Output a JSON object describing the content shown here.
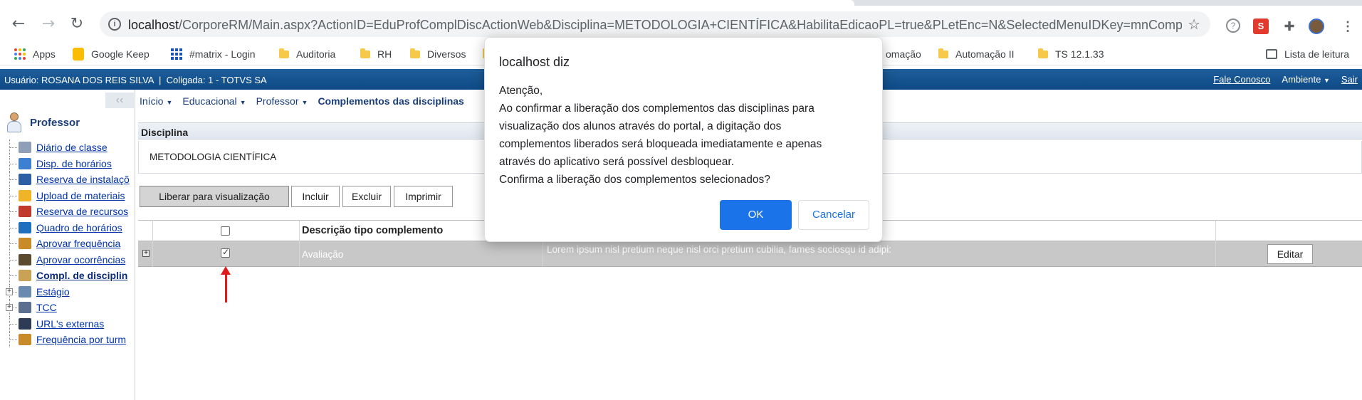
{
  "browser": {
    "url_host": "localhost",
    "url_path": "/CorporeRM/Main.aspx?ActionID=EduProfComplDiscActionWeb&Disciplina=METODOLOGIA+CIENTÍFICA&HabilitaEdicaoPL=true&PLetEnc=N&SelectedMenuIDKey=mnComplDisc...",
    "bookmarks": [
      "Apps",
      "Google Keep",
      "#matrix - Login",
      "Auditoria",
      "RH",
      "Diversos",
      "omação",
      "Automação II",
      "TS 12.1.33"
    ],
    "reading_list": "Lista de leitura",
    "icons": [
      "back-icon",
      "forward-icon",
      "reload-icon",
      "info-icon",
      "star-icon",
      "help-icon",
      "extension-icon",
      "menu-icon"
    ]
  },
  "header": {
    "user_line": "Usuário: ROSANA DOS REIS SILVA  |  Coligada: 1 - TOTVS SA",
    "fale_conosco": "Fale Conosco",
    "ambiente": "Ambiente",
    "sair": "Sair"
  },
  "sidebar": {
    "collapse_glyph": "‹‹",
    "title": "Professor",
    "items": [
      {
        "label": "Diário de classe",
        "icon_color": "#8f9fb8"
      },
      {
        "label": "Disp. de horários",
        "icon_color": "#3d7fd1"
      },
      {
        "label": "Reserva de instalaçõ",
        "icon_color": "#2b5ea3"
      },
      {
        "label": "Upload de materiais",
        "icon_color": "#f0b429"
      },
      {
        "label": "Reserva de recursos",
        "icon_color": "#c0392b"
      },
      {
        "label": "Quadro de horários",
        "icon_color": "#1f6fbf"
      },
      {
        "label": "Aprovar frequência",
        "icon_color": "#c98b2a"
      },
      {
        "label": "Aprovar ocorrências",
        "icon_color": "#5b4a2e"
      },
      {
        "label": "Compl. de disciplin",
        "icon_color": "#c9a255"
      },
      {
        "label": "Estágio",
        "icon_color": "#6a8ab0"
      },
      {
        "label": "TCC",
        "icon_color": "#5a6f8f"
      },
      {
        "label": "URL's externas",
        "icon_color": "#2e3b55"
      },
      {
        "label": "Frequência por turm",
        "icon_color": "#c98b2a"
      }
    ]
  },
  "breadcrumb": {
    "inicio": "Início",
    "educacional": "Educacional",
    "professor": "Professor",
    "current": "Complementos das disciplinas"
  },
  "disciplina": {
    "label": "Disciplina",
    "value": "METODOLOGIA CIENTÍFICA"
  },
  "toolbar": {
    "liberar": "Liberar para visualização",
    "incluir": "Incluir",
    "excluir": "Excluir",
    "imprimir": "Imprimir"
  },
  "grid": {
    "header_descricao": "Descrição tipo complemento",
    "rows": [
      {
        "expand": "+",
        "tipo": "Avaliação",
        "texto": "Lorem ipsum nisl pretium neque nisl orci pretium cubilia, fames sociosqu id adipi:",
        "action": "Editar"
      }
    ]
  },
  "dialog": {
    "title": "localhost diz",
    "lines": [
      "Atenção,",
      "Ao confirmar a liberação dos complementos das disciplinas para",
      "visualização dos alunos através do portal, a digitação dos",
      "complementos liberados será bloqueada imediatamente e apenas",
      "através do aplicativo será possível desbloquear.",
      "Confirma a liberação dos complementos selecionados?"
    ],
    "ok": "OK",
    "cancel": "Cancelar"
  },
  "colors": {
    "header_bg": "#0d4a86",
    "link": "#0033aa",
    "annotation_arrow": "#e01b1b",
    "dialog_primary": "#1a73e8"
  }
}
